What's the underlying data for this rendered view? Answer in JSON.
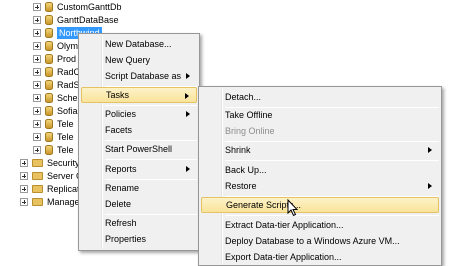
{
  "tree": {
    "items": [
      {
        "label": "CustomGanttDb",
        "icon": "database-icon"
      },
      {
        "label": "GanttDataBase",
        "icon": "database-icon"
      },
      {
        "label": "Northwind",
        "icon": "database-icon",
        "selected": true
      },
      {
        "label": "Olym",
        "icon": "database-icon"
      },
      {
        "label": "Prod",
        "icon": "database-icon"
      },
      {
        "label": "RadC",
        "icon": "database-icon"
      },
      {
        "label": "RadS",
        "icon": "database-icon"
      },
      {
        "label": "Sche",
        "icon": "database-icon"
      },
      {
        "label": "Sofia",
        "icon": "database-icon"
      },
      {
        "label": "Tele",
        "icon": "database-icon"
      },
      {
        "label": "Tele",
        "icon": "database-icon"
      },
      {
        "label": "Tele",
        "icon": "database-icon"
      },
      {
        "label": "Security",
        "icon": "folder-icon"
      },
      {
        "label": "Server O",
        "icon": "folder-icon"
      },
      {
        "label": "Replicatio",
        "icon": "folder-icon"
      },
      {
        "label": "Managen",
        "icon": "folder-icon"
      }
    ]
  },
  "context_menu": {
    "items": [
      {
        "label": "New Database..."
      },
      {
        "label": "New Query"
      },
      {
        "label": "Script Database as",
        "submenu": true
      },
      {
        "label": "Tasks",
        "submenu": true,
        "highlighted": true
      },
      {
        "label": "Policies",
        "submenu": true
      },
      {
        "label": "Facets"
      },
      {
        "label": "Start PowerShell"
      },
      {
        "label": "Reports",
        "submenu": true
      },
      {
        "label": "Rename"
      },
      {
        "label": "Delete"
      },
      {
        "label": "Refresh"
      },
      {
        "label": "Properties"
      }
    ]
  },
  "tasks_menu": {
    "items": [
      {
        "label": "Detach..."
      },
      {
        "label": "Take Offline"
      },
      {
        "label": "Bring Online",
        "disabled": true
      },
      {
        "label": "Shrink",
        "submenu": true
      },
      {
        "label": "Back Up..."
      },
      {
        "label": "Restore",
        "submenu": true
      },
      {
        "label": "Generate Scripts...",
        "highlighted": true
      },
      {
        "label": "Extract Data-tier Application..."
      },
      {
        "label": "Deploy Database to a Windows Azure VM..."
      },
      {
        "label": "Export Data-tier Application..."
      }
    ]
  },
  "colors": {
    "selection": "#3399ff",
    "menu_background": "#f0f0f0",
    "menu_highlight": "#f9e49a"
  }
}
